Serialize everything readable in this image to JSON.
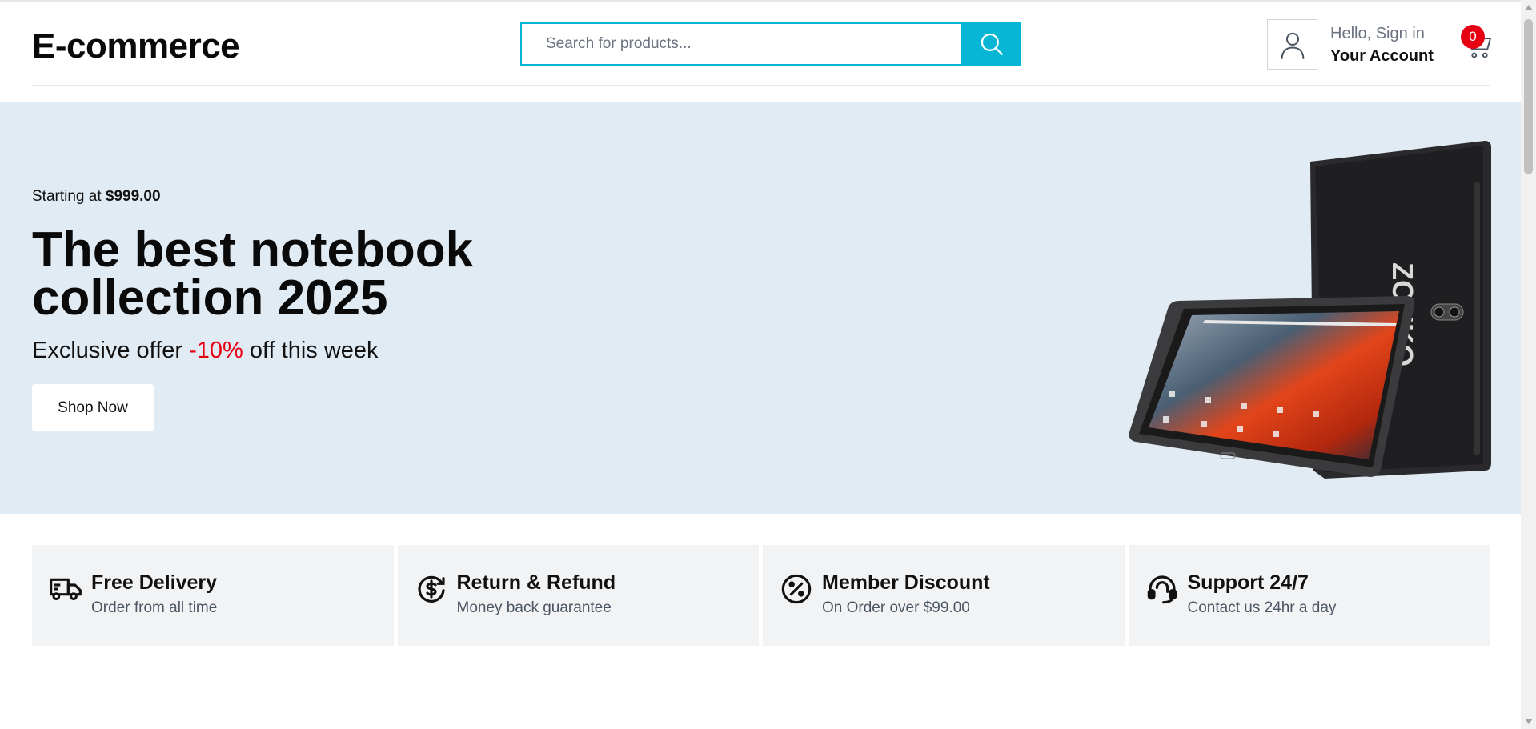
{
  "header": {
    "logo": "E-commerce",
    "search_placeholder": "Search for products...",
    "account_hello": "Hello, Sign in",
    "account_label": "Your Account",
    "cart_count": "0",
    "accent_color": "#06b6d4",
    "badge_color": "#e60012"
  },
  "hero": {
    "starting_prefix": "Starting at ",
    "starting_price": "$999.00",
    "title": "The best notebook collection 2025",
    "offer_prefix": "Exclusive offer ",
    "offer_percent": "-10%",
    "offer_suffix": " off this week",
    "button_label": "Shop Now",
    "background_color": "#e1ebf3",
    "image_text": "ZONKO"
  },
  "features": [
    {
      "icon": "truck-icon",
      "title": "Free Delivery",
      "subtitle": "Order from all time"
    },
    {
      "icon": "dollar-refund-icon",
      "title": "Return & Refund",
      "subtitle": "Money back guarantee"
    },
    {
      "icon": "percent-icon",
      "title": "Member Discount",
      "subtitle": "On Order over $99.00"
    },
    {
      "icon": "headset-icon",
      "title": "Support 24/7",
      "subtitle": "Contact us 24hr a day"
    }
  ]
}
